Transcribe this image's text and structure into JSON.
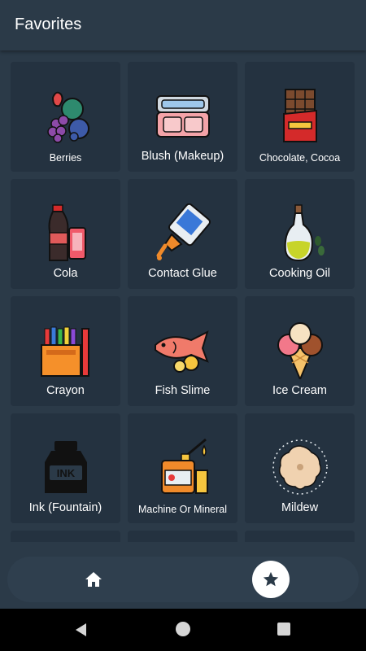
{
  "appbar": {
    "title": "Favorites"
  },
  "items": [
    {
      "label": "Berries",
      "icon": "berries-icon"
    },
    {
      "label": "Blush (Makeup)",
      "icon": "blush-icon"
    },
    {
      "label": "Chocolate, Cocoa",
      "icon": "chocolate-icon"
    },
    {
      "label": "Cola",
      "icon": "cola-icon"
    },
    {
      "label": "Contact Glue",
      "icon": "glue-icon"
    },
    {
      "label": "Cooking Oil",
      "icon": "oil-icon"
    },
    {
      "label": "Crayon",
      "icon": "crayon-icon"
    },
    {
      "label": "Fish Slime",
      "icon": "fish-icon"
    },
    {
      "label": "Ice Cream",
      "icon": "ice-cream-icon"
    },
    {
      "label": "Ink (Fountain)",
      "icon": "ink-icon",
      "icon_text": "INK"
    },
    {
      "label": "Machine Or Mineral",
      "icon": "oil-can-icon"
    },
    {
      "label": "Mildew",
      "icon": "mildew-icon"
    }
  ],
  "nav": {
    "home_icon": "home-icon",
    "favorites_icon": "star-icon"
  },
  "colors": {
    "background": "#2b3a48",
    "tile": "#243240",
    "navbar": "#2f3f4e"
  }
}
